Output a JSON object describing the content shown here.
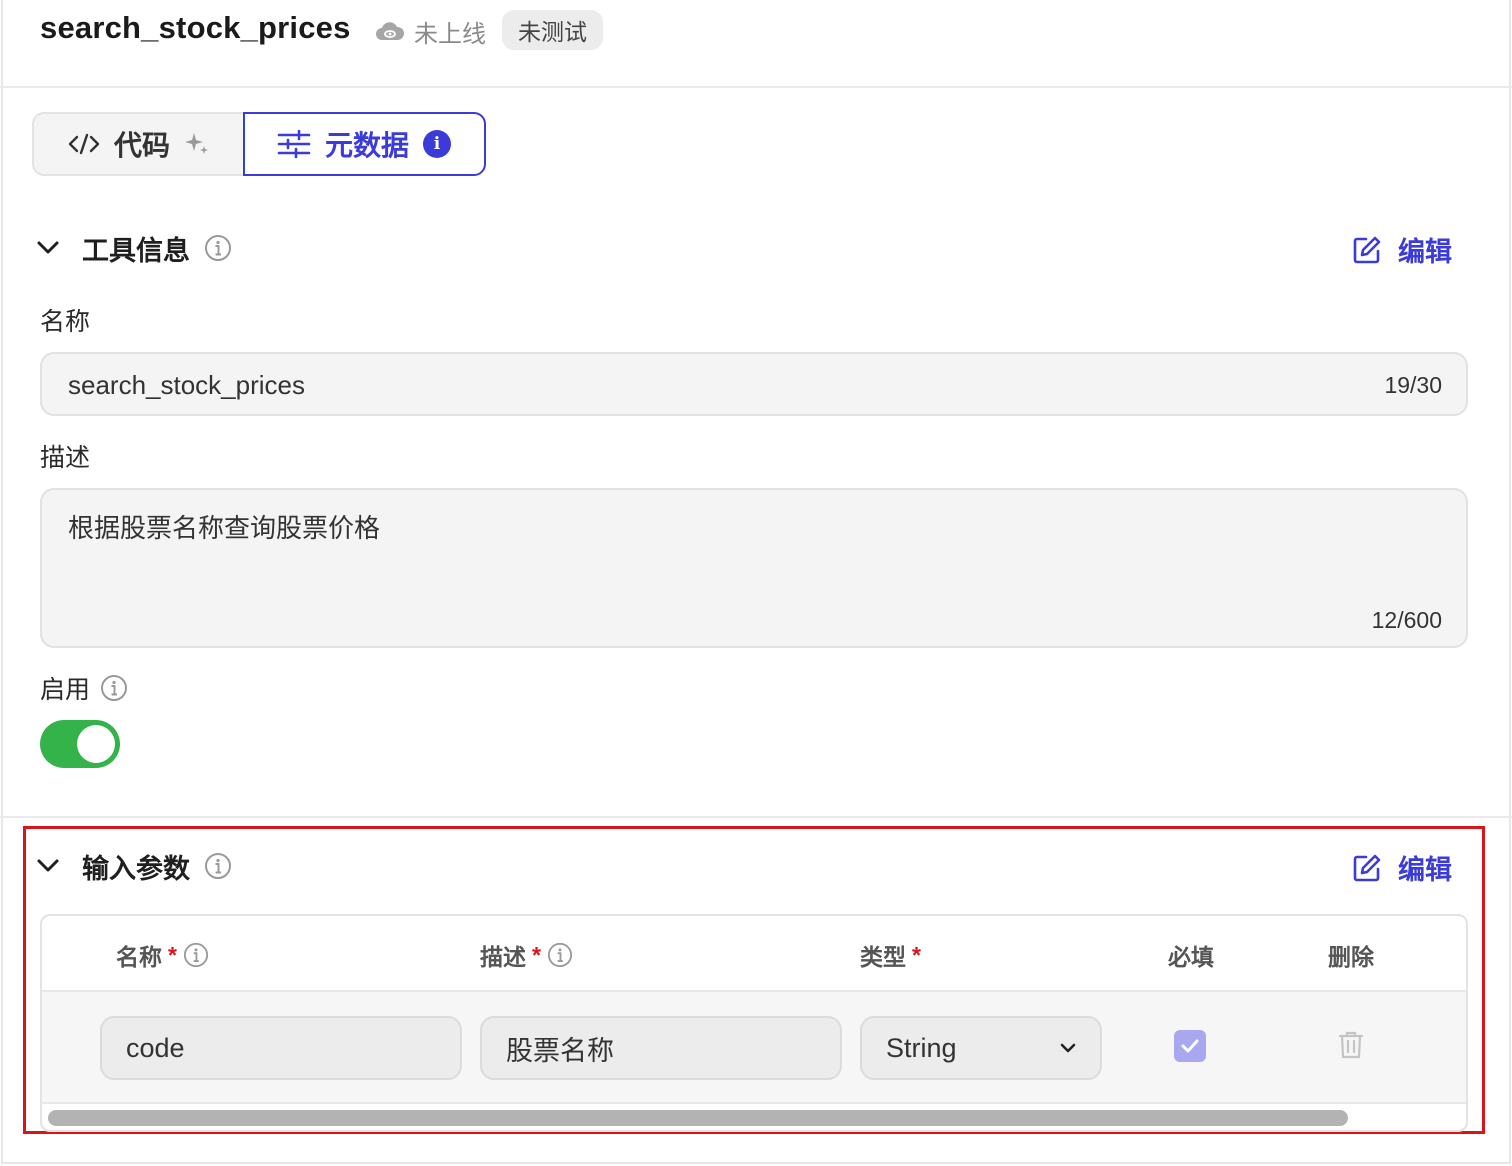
{
  "header": {
    "tool_name": "search_stock_prices",
    "deploy_status": "未上线",
    "test_status": "未测试"
  },
  "tabs": [
    {
      "label": "代码",
      "active": false
    },
    {
      "label": "元数据",
      "active": true
    }
  ],
  "tool_info": {
    "title": "工具信息",
    "edit_label": "编辑",
    "name_label": "名称",
    "name_value": "search_stock_prices",
    "name_count": "19/30",
    "desc_label": "描述",
    "desc_value": "根据股票名称查询股票价格",
    "desc_count": "12/600",
    "enable_label": "启用",
    "enabled": true
  },
  "input_params": {
    "title": "输入参数",
    "edit_label": "编辑",
    "columns": {
      "name": "名称",
      "desc": "描述",
      "type": "类型",
      "required": "必填",
      "delete": "删除"
    },
    "required_mark": "*",
    "rows": [
      {
        "name": "code",
        "desc": "股票名称",
        "type": "String",
        "required": true
      }
    ]
  },
  "colors": {
    "accent": "#3b3bd8",
    "toggle_on": "#33b34a",
    "highlight_border": "#d9141b"
  }
}
